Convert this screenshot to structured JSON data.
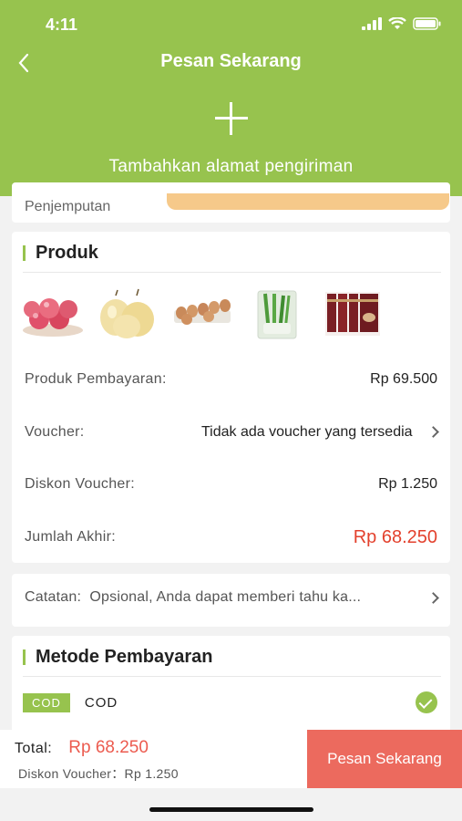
{
  "status_bar": {
    "time": "4:11"
  },
  "nav": {
    "title": "Pesan Sekarang"
  },
  "address": {
    "add_label": "Tambahkan alamat pengiriman"
  },
  "pickup": {
    "label": "Penjemputan"
  },
  "products": {
    "title": "Produk",
    "thumbnails": [
      "apples",
      "pears",
      "eggs",
      "spring-onions",
      "coffee-sachets"
    ],
    "rows": {
      "subtotal_label": "Produk Pembayaran:",
      "subtotal_value": "Rp 69.500",
      "voucher_label": "Voucher:",
      "voucher_value": "Tidak ada voucher yang tersedia",
      "discount_label": "Diskon Voucher:",
      "discount_value": "Rp 1.250",
      "final_label": "Jumlah Akhir:",
      "final_value": "Rp 68.250"
    }
  },
  "notes": {
    "label": "Catatan:",
    "placeholder": "Opsional, Anda dapat memberi tahu ka..."
  },
  "payment": {
    "title": "Metode Pembayaran",
    "badge": "COD",
    "method_label": "COD",
    "selected": true
  },
  "bottom": {
    "total_label": "Total:",
    "total_value": "Rp 68.250",
    "discount_text": "Diskon Voucher：Rp 1.250",
    "order_button": "Pesan Sekarang"
  },
  "colors": {
    "brand_green": "#97c34e",
    "price_red": "#e3412d",
    "button_red": "#ec6a5e"
  }
}
